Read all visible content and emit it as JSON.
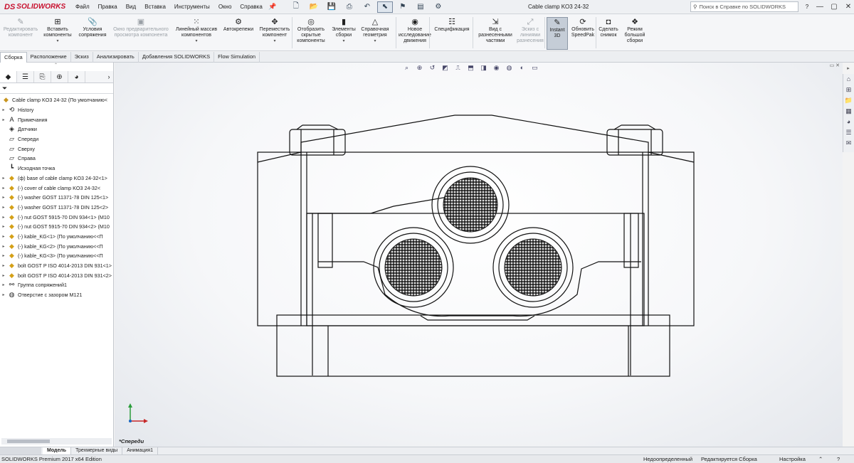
{
  "app": {
    "logo_text": "SOLIDWORKS",
    "logo_mark": "DS",
    "doc_title": "Cable clamp KO3 24-32",
    "help_search_placeholder": "Поиск в Справке по SOLIDWORKS",
    "brand_color": "#c8102e"
  },
  "menu": [
    "Файл",
    "Правка",
    "Вид",
    "Вставка",
    "Инструменты",
    "Окно",
    "Справка"
  ],
  "ribbon": [
    {
      "label": "Редактировать компонент",
      "icon": "edit-component-icon",
      "glyph": "✎",
      "disabled": true,
      "arrow": false
    },
    {
      "label": "Вставить компоненты",
      "icon": "insert-components-icon",
      "glyph": "⊞",
      "disabled": false,
      "arrow": true
    },
    {
      "label": "Условия сопряжения",
      "icon": "mate-icon",
      "glyph": "📎",
      "disabled": false,
      "arrow": false
    },
    {
      "label": "Окно предварительного просмотра компонента",
      "icon": "component-preview-icon",
      "glyph": "▣",
      "disabled": true,
      "arrow": false
    },
    {
      "label": "Линейный массив компонентов",
      "icon": "linear-pattern-icon",
      "glyph": "⁙",
      "disabled": false,
      "arrow": true
    },
    {
      "label": "Автокрепежи",
      "icon": "smart-fasteners-icon",
      "glyph": "⚙",
      "disabled": false,
      "arrow": false
    },
    {
      "label": "Переместить компонент",
      "icon": "move-component-icon",
      "glyph": "✥",
      "disabled": false,
      "arrow": true
    },
    {
      "label": "Отобразить скрытые компоненты",
      "icon": "show-hidden-icon",
      "glyph": "◎",
      "disabled": false,
      "arrow": false
    },
    {
      "label": "Элементы сборки",
      "icon": "assembly-features-icon",
      "glyph": "▮",
      "disabled": false,
      "arrow": true
    },
    {
      "label": "Справочная геометрия",
      "icon": "reference-geometry-icon",
      "glyph": "△",
      "disabled": false,
      "arrow": true
    },
    {
      "label": "Новое исследование движения",
      "icon": "motion-study-icon",
      "glyph": "◉",
      "disabled": false,
      "arrow": false
    },
    {
      "label": "Спецификация",
      "icon": "bom-icon",
      "glyph": "☷",
      "disabled": false,
      "arrow": false
    },
    {
      "label": "Вид с разнесенными частями",
      "icon": "exploded-view-icon",
      "glyph": "⇲",
      "disabled": false,
      "arrow": false
    },
    {
      "label": "Эскиз с линиями разнесения",
      "icon": "explode-line-sketch-icon",
      "glyph": "⤢",
      "disabled": true,
      "arrow": false
    },
    {
      "label": "Instant 3D",
      "icon": "instant3d-icon",
      "glyph": "✎",
      "disabled": false,
      "arrow": false,
      "active": true
    },
    {
      "label": "Обновить SpeedPak",
      "icon": "speedpak-icon",
      "glyph": "⟳",
      "disabled": false,
      "arrow": false
    },
    {
      "label": "Сделать снимок",
      "icon": "snapshot-icon",
      "glyph": "◘",
      "disabled": false,
      "arrow": false
    },
    {
      "label": "Режим большой сборки",
      "icon": "large-assembly-icon",
      "glyph": "❖",
      "disabled": false,
      "arrow": false
    }
  ],
  "tabs": [
    "Сборка",
    "Расположение",
    "Эскиз",
    "Анализировать",
    "Добавления SOLIDWORKS",
    "Flow Simulation"
  ],
  "tree": {
    "root": "Cable clamp KO3 24-32  (По умолчанию<",
    "items": [
      {
        "label": "History",
        "icon": "history-icon",
        "glyph": "⟲",
        "expandable": true
      },
      {
        "label": "Примечания",
        "icon": "annotations-icon",
        "glyph": "A",
        "expandable": true
      },
      {
        "label": "Датчики",
        "icon": "sensors-icon",
        "glyph": "◈",
        "expandable": false
      },
      {
        "label": "Спереди",
        "icon": "plane-icon",
        "glyph": "▱",
        "expandable": false
      },
      {
        "label": "Сверху",
        "icon": "plane-icon",
        "glyph": "▱",
        "expandable": false
      },
      {
        "label": "Справа",
        "icon": "plane-icon",
        "glyph": "▱",
        "expandable": false
      },
      {
        "label": "Исходная точка",
        "icon": "origin-icon",
        "glyph": "┗",
        "expandable": false
      },
      {
        "label": "(ф) base of cable clamp KO3 24-32<1>",
        "icon": "part-icon",
        "glyph": "◆",
        "expandable": true
      },
      {
        "label": "(-) cover of cable clamp KO3 24-32<",
        "icon": "part-icon",
        "glyph": "◆",
        "expandable": true
      },
      {
        "label": "(-) washer GOST 11371-78 DIN 125<1>",
        "icon": "part-icon",
        "glyph": "◆",
        "expandable": true
      },
      {
        "label": "(-) washer GOST 11371-78 DIN 125<2>",
        "icon": "part-icon",
        "glyph": "◆",
        "expandable": true
      },
      {
        "label": "(-) nut GOST 5915-70 DIN 934<1> (M10",
        "icon": "part-icon",
        "glyph": "◆",
        "expandable": true
      },
      {
        "label": "(-) nut GOST 5915-70 DIN 934<2> (M10",
        "icon": "part-icon",
        "glyph": "◆",
        "expandable": true
      },
      {
        "label": "(-) kable_KG<1> (По умолчанию<<П",
        "icon": "part-icon",
        "glyph": "◆",
        "expandable": true
      },
      {
        "label": "(-) kable_KG<2> (По умолчанию<<П",
        "icon": "part-icon",
        "glyph": "◆",
        "expandable": true
      },
      {
        "label": "(-) kable_KG<3> (По умолчанию<<П",
        "icon": "part-icon",
        "glyph": "◆",
        "expandable": true
      },
      {
        "label": "bolt GOST P ISO 4014-2013 DIN 931<1>",
        "icon": "part-icon",
        "glyph": "◆",
        "expandable": true
      },
      {
        "label": "bolt GOST P ISO 4014-2013 DIN 931<2>",
        "icon": "part-icon",
        "glyph": "◆",
        "expandable": true
      },
      {
        "label": "Группа сопряжений1",
        "icon": "mates-folder-icon",
        "glyph": "⚯",
        "expandable": true
      },
      {
        "label": "Отверстие с зазором M121",
        "icon": "hole-icon",
        "glyph": "◍",
        "expandable": true
      }
    ]
  },
  "viewport": {
    "view_name": "*Спереди"
  },
  "bottom_tabs": [
    "Модель",
    "Трехмерные виды",
    "Анимация1"
  ],
  "status": {
    "left": "SOLIDWORKS Premium 2017 x64 Edition",
    "state": "Недоопределенный",
    "editing": "Редактируется Сборка",
    "settings": "Настройка"
  }
}
